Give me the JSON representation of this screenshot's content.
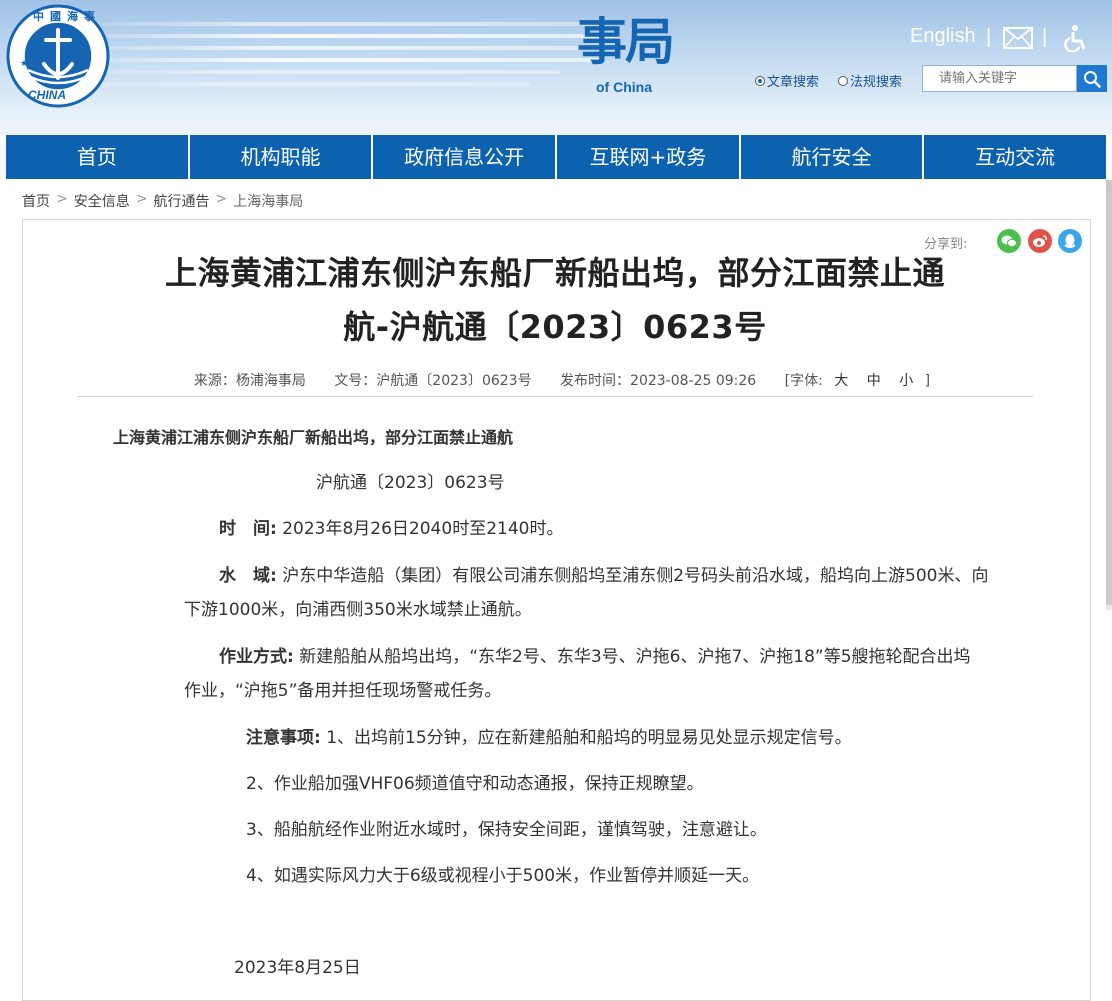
{
  "header": {
    "logo_text": "中國海事",
    "logo_sub": "CHINA",
    "brand_visible": "事局",
    "brand_sub": "of China",
    "english_link": "English",
    "separator": "|",
    "search_options": [
      "文章搜索",
      "法规搜索"
    ],
    "search_placeholder": "请输入关键字"
  },
  "nav": {
    "items": [
      "首页",
      "机构职能",
      "政府信息公开",
      "互联网+政务",
      "航行安全",
      "互动交流"
    ]
  },
  "breadcrumb": {
    "items": [
      "首页",
      "安全信息",
      "航行通告",
      "上海海事局"
    ],
    "sep": ">"
  },
  "share": {
    "label": "分享到:"
  },
  "article": {
    "title_line1": "上海黄浦江浦东侧沪东船厂新船出坞，部分江面禁止通",
    "title_line2": "航-沪航通〔2023〕0623号",
    "meta": {
      "source": "来源：杨浦海事局",
      "doc_no": "文号：沪航通〔2023〕0623号",
      "time": "发布时间：2023-08-25 09:26",
      "font_label": "[字体:",
      "font_large": "大",
      "font_mid": "中",
      "font_small": "小",
      "font_close": "]"
    },
    "heading": "上海黄浦江浦东侧沪东船厂新船出坞，部分江面禁止通航",
    "doc_number": "沪航通〔2023〕0623号",
    "time_label": "时　间:",
    "time_value": "2023年8月26日2040时至2140时。",
    "water_label": "水　域:",
    "water_value_1": "沪东中华造船（集团）有限公司浦东侧船坞至浦东侧2号码头前沿水域，船坞向上游500米、向",
    "water_value_2": "下游1000米，向浦西侧350米水域禁止通航。",
    "work_label": "作业方式:",
    "work_value_1": " 新建船舶从船坞出坞，“东华2号、东华3号、沪拖6、沪拖7、沪拖18”等5艘拖轮配合出坞",
    "work_value_2": "作业，“沪拖5”备用并担任现场警戒任务。",
    "notes_label": "注意事项:",
    "note_1": "1、出坞前15分钟，应在新建船舶和船坞的明显易见处显示规定信号。",
    "note_2": "2、作业船加强VHF06频道值守和动态通报，保持正规瞭望。",
    "note_3": "3、船舶航经作业附近水域时，保持安全间距，谨慎驾驶，注意避让。",
    "note_4": "4、如遇实际风力大于6级或视程小于500米，作业暂停并顺延一天。",
    "date": "2023年8月25日"
  },
  "colors": {
    "nav_bg": "#0d62b0",
    "brand_blue": "#1565b3",
    "wechat": "#4cbf4c",
    "weibo": "#e0524a",
    "qq": "#3aa6e8"
  }
}
